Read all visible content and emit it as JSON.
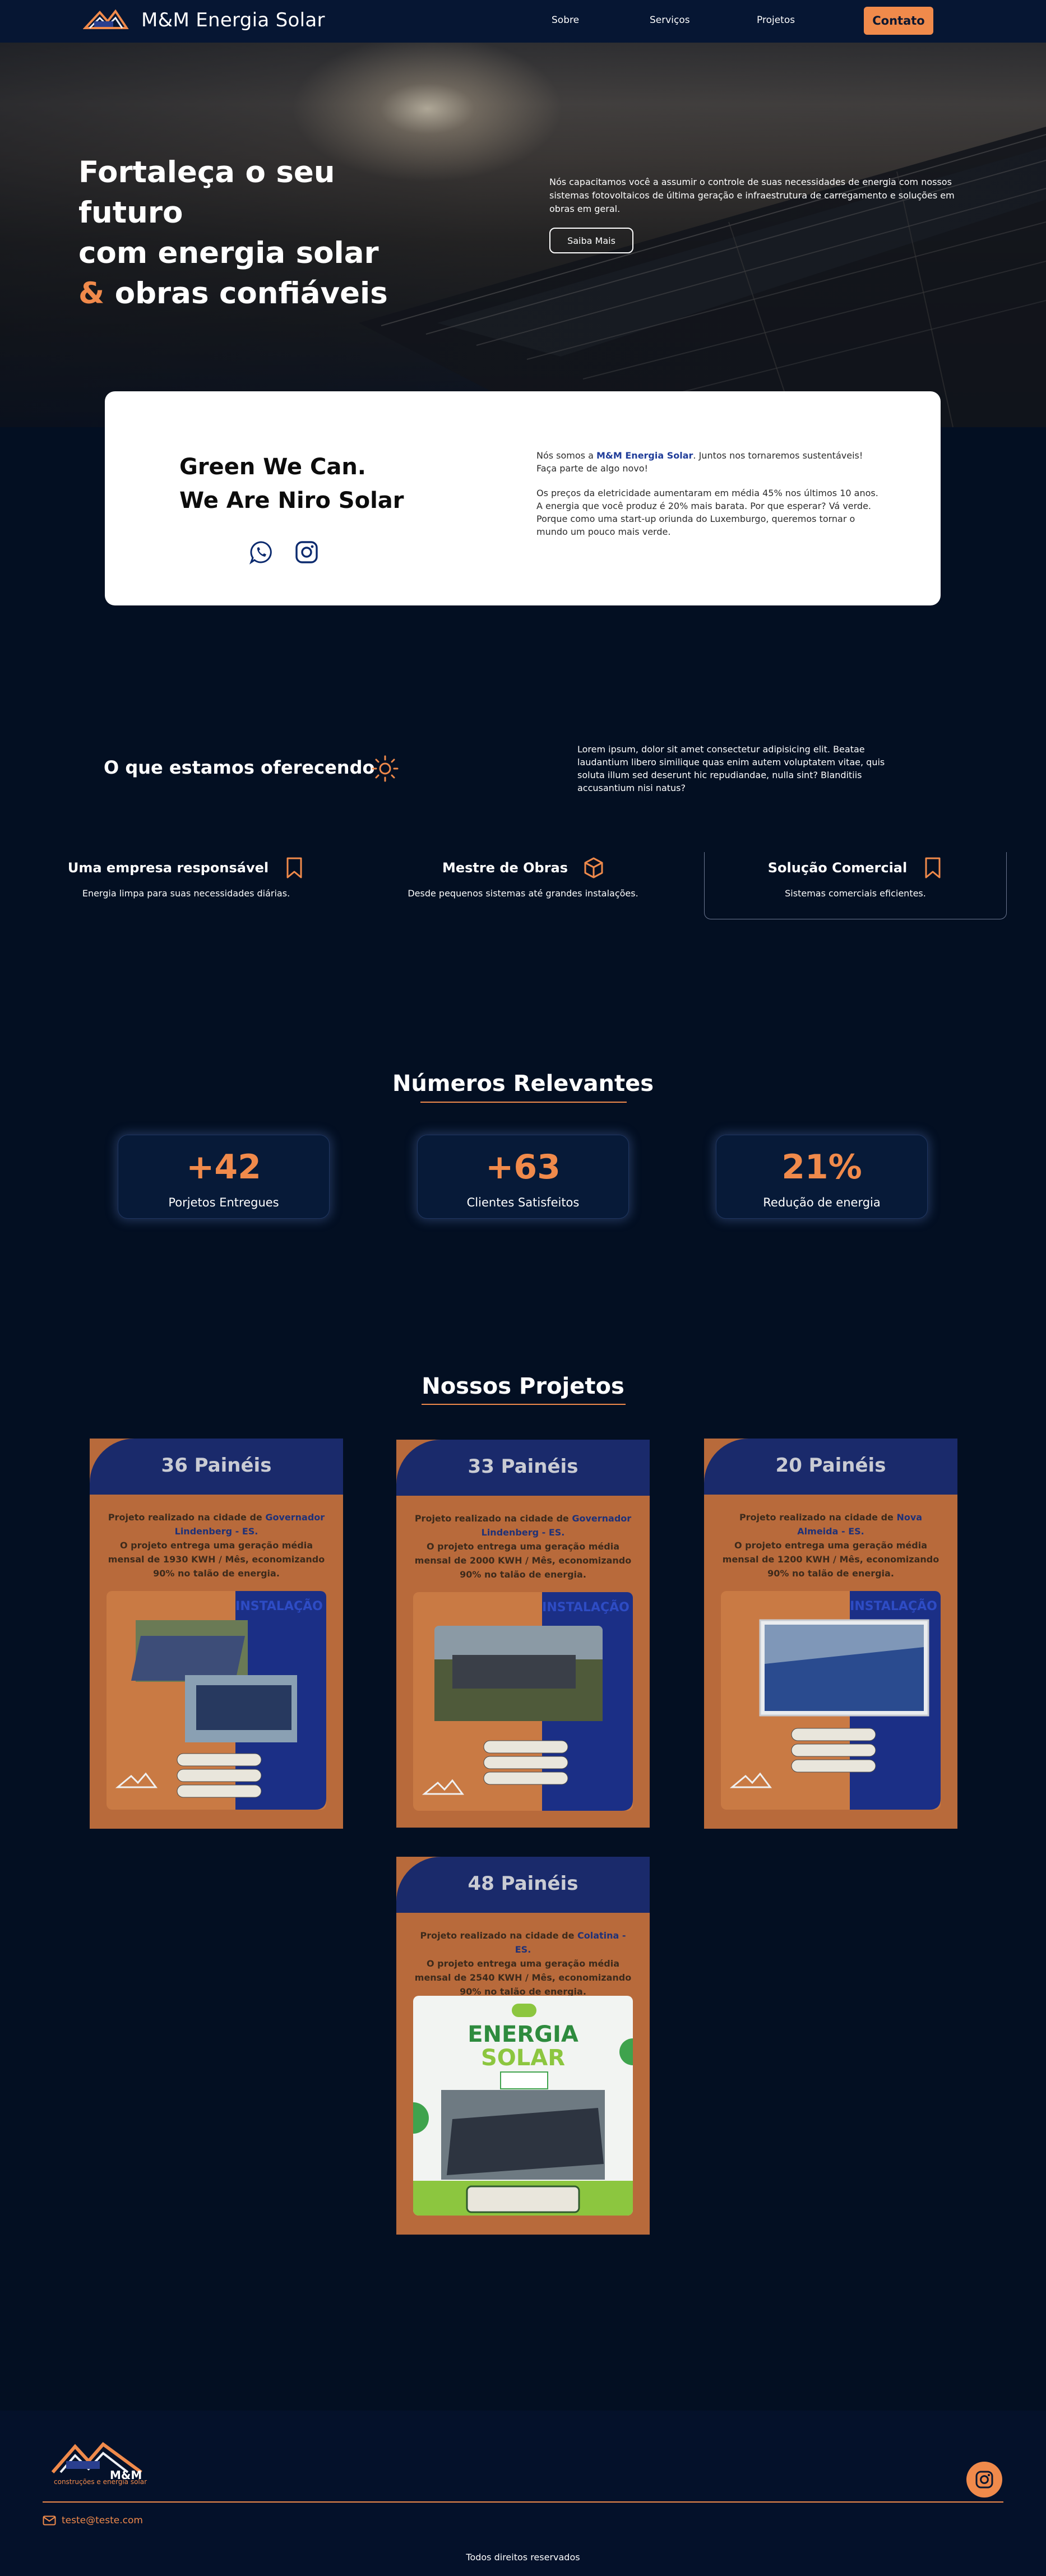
{
  "nav": {
    "brand": "M&M Energia Solar",
    "links": [
      "Sobre",
      "Serviços",
      "Projetos"
    ],
    "cta": "Contato"
  },
  "hero": {
    "title_line1": "Fortaleça o seu futuro",
    "title_line2": "com energia solar",
    "title_amp": "&",
    "title_line3": "obras confiáveis",
    "text": "Nós capacitamos você a assumir o controle de suas necessidades de energia com nossos sistemas fotovoltaicos de última geração e infraestrutura de carregamento e soluções em obras em geral.",
    "button": "Saiba Mais"
  },
  "about": {
    "title_line1": "Green We Can.",
    "title_line2": "We Are Niro Solar",
    "p1_before": "Nós somos a ",
    "p1_highlight": "M&M Energia Solar",
    "p1_after": ". Juntos nos tornaremos sustentáveis! Faça parte de algo novo!",
    "p2": "Os preços da eletricidade aumentaram em média 45% nos últimos 10 anos. A energia que você produz é 20% mais barata. Por que esperar? Vá verde. Porque como uma start-up oriunda do Luxemburgo, queremos tornar o mundo um pouco mais verde."
  },
  "offer": {
    "title": "O que estamos oferecendo",
    "text": "Lorem ipsum, dolor sit amet consectetur adipisicing elit. Beatae laudantium libero similique quas enim autem voluptatem vitae, quis soluta illum sed deserunt hic repudiandae, nulla sint? Blanditiis accusantium nisi natus?",
    "features": [
      {
        "title": "Uma empresa responsável",
        "desc": "Energia limpa para suas necessidades diárias.",
        "icon": "bookmark-icon"
      },
      {
        "title": "Mestre de Obras",
        "desc": "Desde pequenos sistemas até grandes instalações.",
        "icon": "cube-icon"
      },
      {
        "title": "Solução Comercial",
        "desc": "Sistemas comerciais eficientes.",
        "icon": "bookmark-icon"
      }
    ]
  },
  "numbers": {
    "title": "Números Relevantes",
    "stats": [
      {
        "value": "+42",
        "label": "Porjetos Entregues"
      },
      {
        "value": "+63",
        "label": "Clientes Satisfeitos"
      },
      {
        "value": "21%",
        "label": "Redução de energia"
      }
    ]
  },
  "projects": {
    "title": "Nossos Projetos",
    "items": [
      {
        "title": "36 Painéis",
        "pre": "Projeto realizado na cidade de ",
        "city": "Governador Lindenberg - ES.",
        "post": "O projeto entrega uma geração média mensal de 1930 KWH / Mês, economizando 90% no talão de energia.",
        "img_label": "INSTALAÇÃO"
      },
      {
        "title": "33 Painéis",
        "pre": "Projeto realizado na cidade de ",
        "city": "Governador Lindenberg - ES.",
        "post": "O projeto entrega uma geração média mensal de 2000 KWH / Mês, economizando 90% no talão de energia.",
        "img_label": "INSTALAÇÃO"
      },
      {
        "title": "20 Painéis",
        "pre": "Projeto realizado na cidade de ",
        "city": "Nova Almeida - ES.",
        "post": "O projeto entrega uma geração média mensal de 1200 KWH / Mês, economizando 90% no talão de energia.",
        "img_label": "INSTALAÇÃO"
      },
      {
        "title": "48 Painéis",
        "pre": "Projeto realizado na cidade de ",
        "city": "Colatina - ES.",
        "post": "O projeto entrega uma geração média mensal de 2540 KWH / Mês, economizando 90% no talão de energia.",
        "img_label1": "ENERGIA",
        "img_label2": "SOLAR"
      }
    ]
  },
  "footer": {
    "logo_text": "M&M",
    "logo_sub": "construções e energia solar",
    "email": "teste@teste.com",
    "copyright": "Todos direitos reservados"
  },
  "colors": {
    "accent": "#f08a4b",
    "navy": "#030f22",
    "card_blue": "#1a2a6b",
    "project_orange": "#b86a3b"
  }
}
